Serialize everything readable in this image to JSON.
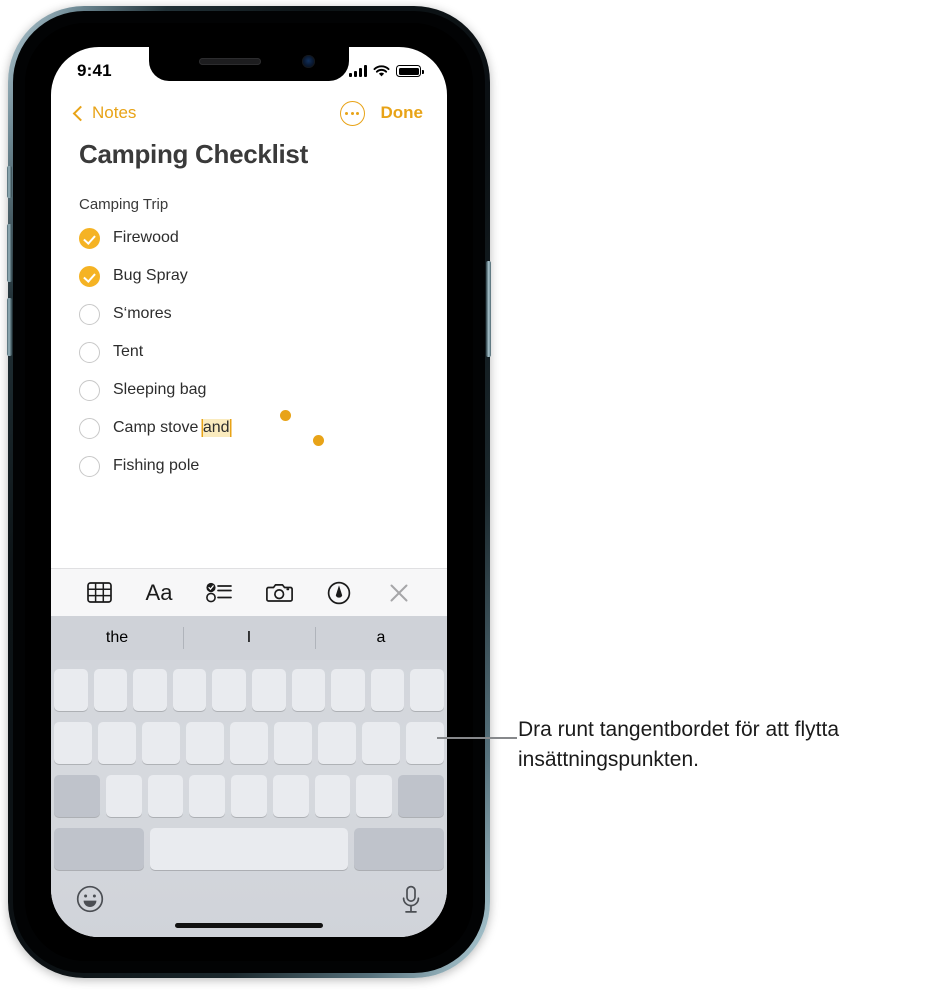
{
  "device": {
    "status_bar": {
      "time": "9:41",
      "cellular_icon": "signal-bars-icon",
      "wifi_icon": "wifi-icon",
      "battery_icon": "battery-icon"
    },
    "notch": {
      "speaker_icon": "earpiece-speaker",
      "camera_icon": "front-camera"
    },
    "home_indicator": "home-indicator"
  },
  "nav": {
    "back_icon": "chevron-left-icon",
    "back_label": "Notes",
    "more_icon": "ellipsis-circle-icon",
    "done_label": "Done"
  },
  "note": {
    "title": "Camping Checklist",
    "subtitle": "Camping Trip",
    "items": [
      {
        "label": "Firewood",
        "checked": true
      },
      {
        "label": "Bug Spray",
        "checked": true
      },
      {
        "label": "S‘mores",
        "checked": false
      },
      {
        "label": "Tent",
        "checked": false
      },
      {
        "label": "Sleeping bag",
        "checked": false
      },
      {
        "label": "Camp stove ",
        "checked": false,
        "selected_text": "and"
      },
      {
        "label": "Fishing pole",
        "checked": false
      }
    ],
    "selection": {
      "text": "and",
      "handle_color": "#E8A317",
      "highlight_color": "#FAEBBE"
    }
  },
  "format_toolbar": {
    "items": [
      {
        "name": "table-icon",
        "label": "Table"
      },
      {
        "name": "format-aa-icon",
        "label": "Aa"
      },
      {
        "name": "checklist-icon",
        "label": "Checklist"
      },
      {
        "name": "camera-icon",
        "label": "Camera"
      },
      {
        "name": "markup-pen-icon",
        "label": "Markup"
      },
      {
        "name": "close-icon",
        "label": "Close"
      }
    ]
  },
  "keyboard": {
    "predictions": [
      "the",
      "I",
      "a"
    ],
    "row1_keys": 10,
    "row2_keys": 9,
    "row3_keys": 7,
    "shift_key": "shift-key",
    "delete_key": "delete-key",
    "numbers_key": "123-key",
    "space_key": "space-key",
    "return_key": "return-key",
    "emoji_icon": "emoji-smiley-icon",
    "dictation_icon": "microphone-icon"
  },
  "callout": {
    "text": "Dra runt tangentbordet för att flytta insättningspunkten."
  },
  "colors": {
    "accent": "#E8A317",
    "check_fill": "#F5B324",
    "keyboard_bg": "#D2D5DB",
    "key_bg": "#E9EBEF",
    "key_dark": "#BFC3CB",
    "prediction_bg": "#CFD2D8"
  }
}
